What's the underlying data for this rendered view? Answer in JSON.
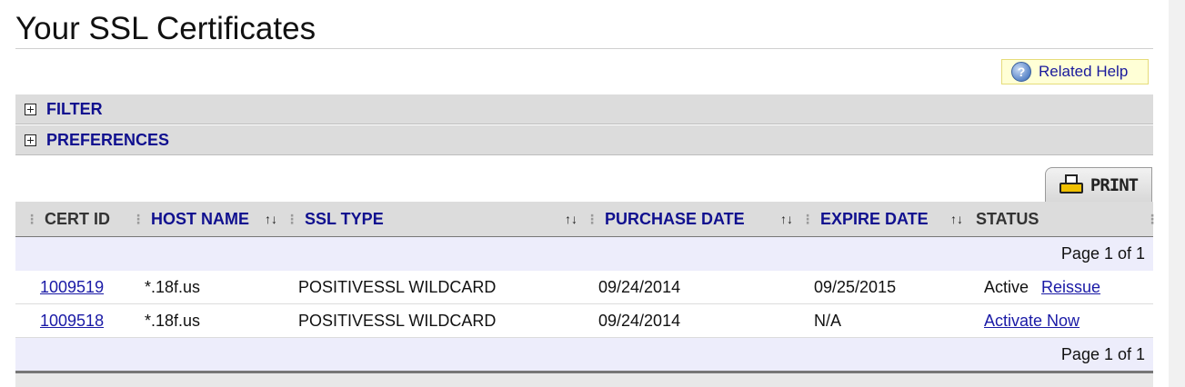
{
  "page": {
    "title": "Your SSL Certificates"
  },
  "related_help": {
    "label": "Related Help",
    "icon": "question-help-icon"
  },
  "sections": [
    {
      "label": "FILTER",
      "icon": "plus-box-icon"
    },
    {
      "label": "PREFERENCES",
      "icon": "plus-box-icon"
    }
  ],
  "print": {
    "label": "PRINT",
    "icon": "printer-icon"
  },
  "table": {
    "columns": [
      {
        "label": "CERT ID",
        "sortable": false
      },
      {
        "label": "HOST NAME",
        "sortable": true
      },
      {
        "label": "SSL TYPE",
        "sortable": true
      },
      {
        "label": "PURCHASE DATE",
        "sortable": true
      },
      {
        "label": "EXPIRE DATE",
        "sortable": true
      },
      {
        "label": "STATUS",
        "sortable": false
      }
    ],
    "sort_glyph": "↑↓",
    "grip_glyph": "⋮",
    "pager_top": "Page 1 of 1",
    "pager_bottom": "Page 1 of 1",
    "rows": [
      {
        "cert_id": "1009519",
        "host_name": "*.18f.us",
        "ssl_type": "POSITIVESSL WILDCARD",
        "purchase_date": "09/24/2014",
        "expire_date": "09/25/2015",
        "status": "Active",
        "action": "Reissue"
      },
      {
        "cert_id": "1009518",
        "host_name": "*.18f.us",
        "ssl_type": "POSITIVESSL WILDCARD",
        "purchase_date": "09/24/2014",
        "expire_date": "N/A",
        "status": "",
        "action": "Activate Now"
      }
    ]
  },
  "colors": {
    "link": "#10108f",
    "header_bg": "#dcdcdc",
    "pager_bg": "#ededfb",
    "help_bg": "#ffffd6"
  }
}
